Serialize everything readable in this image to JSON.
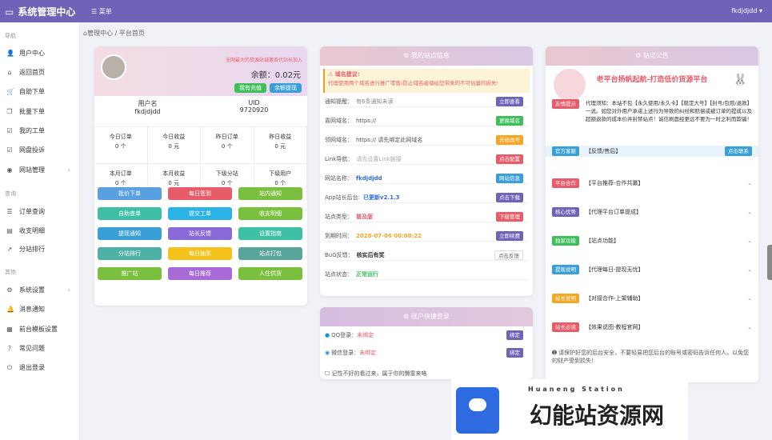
{
  "brand": {
    "title": "系统管理中心"
  },
  "topbar": {
    "menu": "菜单",
    "user": "fkdjdjdd"
  },
  "sidebar": {
    "section_nav": "导航",
    "section_query": "查询",
    "section_other": "其他",
    "items": [
      {
        "label": "用户中心",
        "icon": "user-icon"
      },
      {
        "label": "返回首页",
        "icon": "home-icon"
      },
      {
        "label": "自助下单",
        "icon": "cart-icon"
      },
      {
        "label": "批量下单",
        "icon": "copy-icon"
      },
      {
        "label": "我的工单",
        "icon": "check-icon"
      },
      {
        "label": "网盘投诉",
        "icon": "check-icon"
      },
      {
        "label": "网站管理",
        "icon": "globe-icon"
      },
      {
        "label": "订单查询",
        "icon": "list-icon"
      },
      {
        "label": "收支明细",
        "icon": "chart-icon"
      },
      {
        "label": "分站排行",
        "icon": "trend-icon"
      },
      {
        "label": "系统设置",
        "icon": "gear-icon"
      },
      {
        "label": "消息通知",
        "icon": "bell-icon"
      },
      {
        "label": "前台模板设置",
        "icon": "template-icon"
      },
      {
        "label": "常见问题",
        "icon": "question-icon"
      },
      {
        "label": "退出登录",
        "icon": "power-icon"
      }
    ]
  },
  "breadcrumb": {
    "home": "管理中心",
    "sep": "/",
    "current": "平台首页"
  },
  "profile": {
    "invite": "全网最大的货源站诚邀各代站长加入",
    "balance_label": "余额：",
    "balance": "0.02元",
    "recharge": "我有充值",
    "withdraw": "余额提现",
    "name_label": "用户名",
    "name": "fkdjdjdd",
    "uid_label": "UID",
    "uid": "9720920",
    "stats": [
      {
        "label": "今日订单",
        "value": "0 个"
      },
      {
        "label": "今日收益",
        "value": "0 元"
      },
      {
        "label": "昨日订单",
        "value": "0 个"
      },
      {
        "label": "昨日收益",
        "value": "0 元"
      },
      {
        "label": "本月订单",
        "value": "0 个"
      },
      {
        "label": "本月收益",
        "value": "0 元"
      },
      {
        "label": "下级分站",
        "value": "0 个"
      },
      {
        "label": "下级用户",
        "value": "0 个"
      }
    ],
    "actions": [
      {
        "label": "批价下单",
        "color": "#5aa0e0"
      },
      {
        "label": "每日签到",
        "color": "#e85c6a"
      },
      {
        "label": "站内通知",
        "color": "#7bbf3f"
      },
      {
        "label": "自助查单",
        "color": "#3fc0a5"
      },
      {
        "label": "提交工单",
        "color": "#2bb3e6"
      },
      {
        "label": "收支明细",
        "color": "#7bbf3f"
      },
      {
        "label": "提现通知",
        "color": "#3a9fd6"
      },
      {
        "label": "站长反馈",
        "color": "#8a6ad6"
      },
      {
        "label": "设置指南",
        "color": "#3fc0a5"
      },
      {
        "label": "分站排行",
        "color": "#4fb0a8"
      },
      {
        "label": "每日抽奖",
        "color": "#f5c21b"
      },
      {
        "label": "站点打包",
        "color": "#58a59b"
      },
      {
        "label": "推广站",
        "color": "#7bbf3f"
      },
      {
        "label": "每日推荐",
        "color": "#a86ad6"
      },
      {
        "label": "人住供货",
        "color": "#7bbf3f"
      }
    ]
  },
  "site_info": {
    "title": "我的站点信息",
    "warn_title": "域名建议:",
    "warn_text": "代理使用两个域名进行推广零售(防止域名被墙给您带来的不可估量的损失!",
    "rows": [
      {
        "label": "通知提醒：",
        "value": "有6条通知未读",
        "tag": "立即查看",
        "tag_color": "#6f63b8"
      },
      {
        "label": "喜网域名：",
        "value": "https://",
        "tag": "更换域名",
        "tag_color": "#3fbf5a"
      },
      {
        "label": "领网域名：",
        "value": "https://  请先绑定此网域名",
        "tag": "去修改号",
        "tag_color": "#f5a623"
      },
      {
        "label": "Link导航：",
        "value": "请先设置Link链接",
        "tag": "点击配置",
        "tag_color": "#e85c6a"
      },
      {
        "label": "网站名称：",
        "value": "fkdjdjdd",
        "tag": "网站信息",
        "tag_color": "#3a9fd6"
      },
      {
        "label": "App站长后台:",
        "value": "已更新v2.1.3",
        "tag": "点击下载",
        "tag_color": "#6f63b8"
      },
      {
        "label": "站点类型：",
        "value": "普及版",
        "tag": "下级管理",
        "tag_color": "#e85c6a"
      },
      {
        "label": "到期时间：",
        "value": "2028-07-06 00:08:22",
        "tag": "立即续费",
        "tag_color": "#6f63b8"
      },
      {
        "label": "BuG反馈：",
        "value": "核实后有奖",
        "tag": "点击反馈",
        "tag_color": "#ffffff"
      },
      {
        "label": "站点状态：",
        "value": "正常运行",
        "tag": "",
        "tag_color": ""
      }
    ]
  },
  "quick_login": {
    "title": "账户快捷登录",
    "rows": [
      {
        "label": "QQ登录：",
        "status": "未绑定",
        "tag": "绑定"
      },
      {
        "label": "微信登录：",
        "status": "未绑定",
        "tag": "绑定"
      }
    ],
    "tip": "记性不好的看过来，属于你的懒靠来咯"
  },
  "notice": {
    "title": "站点公告",
    "banner": "老平台扬帆起航-打造低价货源平台",
    "rows": [
      {
        "tag": "友情提示",
        "text": "代理须知：本站不包【永久使用/永久卡】【稳定大号】【封号/包赔/退款】一说。如您对外用户承诺上述行为导致的纠纷和赔偿或被订单的提成以及超额退款的成本价并封禁站点！诚信刷面经更远不要为一时之利而欺骗！",
        "color": "#e85c6a"
      },
      {
        "tag": "官方客服",
        "text": "【反馈/售后】",
        "color": "#3a9fd6",
        "btn": "点击联系"
      },
      {
        "tag": "平台合作",
        "text": "【平台推荐-合作共赢】",
        "color": "#e85c6a"
      },
      {
        "tag": "核心优势",
        "text": "【代理平台订单提成】",
        "color": "#6f63b8"
      },
      {
        "tag": "独家功能",
        "text": "【站点功能】",
        "color": "#3fbf5a"
      },
      {
        "tag": "提现说明",
        "text": "【代理每日-提现无忧】",
        "color": "#3a9fd6"
      },
      {
        "tag": "站长说明",
        "text": "【对接合作-上架辅助】",
        "color": "#f5a623"
      },
      {
        "tag": "站长必读",
        "text": "【效果说图-教程官网】",
        "color": "#e85c6a"
      }
    ],
    "footer": "请保护好您的后台安全，不要轻易把您后台的账号或密码告诉任何人，以免您的财产受到损失！"
  },
  "watermark": {
    "cn": "幻能站资源网",
    "en": "Huaneng Station"
  }
}
